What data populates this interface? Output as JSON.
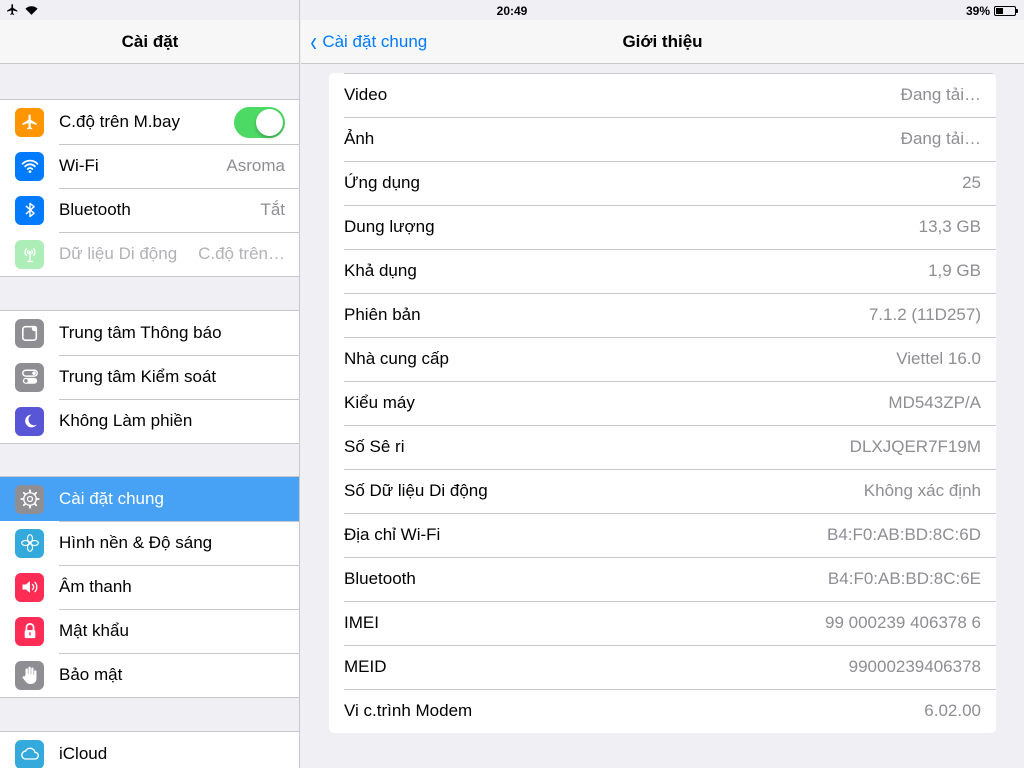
{
  "status_bar": {
    "time": "20:49",
    "battery_percent_text": "39%",
    "battery_level": 0.39
  },
  "sidebar": {
    "title": "Cài đặt",
    "groups": [
      [
        {
          "label": "C.độ trên M.bay",
          "icon": "airplane-icon",
          "icon_color": "#ff9500",
          "toggle_on": true
        },
        {
          "label": "Wi-Fi",
          "value": "Asroma",
          "icon": "wifi-icon",
          "icon_color": "#007aff"
        },
        {
          "label": "Bluetooth",
          "value": "Tắt",
          "icon": "bluetooth-icon",
          "icon_color": "#007aff"
        },
        {
          "label": "Dữ liệu Di động",
          "value": "C.độ trên…",
          "icon": "cellular-icon",
          "icon_color": "#4cd964",
          "disabled": true
        }
      ],
      [
        {
          "label": "Trung tâm Thông báo",
          "icon": "notification-center-icon",
          "icon_color": "#8e8e93"
        },
        {
          "label": "Trung tâm Kiểm soát",
          "icon": "control-center-icon",
          "icon_color": "#8e8e93"
        },
        {
          "label": "Không Làm phiền",
          "icon": "moon-icon",
          "icon_color": "#5856d6"
        }
      ],
      [
        {
          "label": "Cài đặt chung",
          "icon": "gear-icon",
          "icon_color": "#8e8e93",
          "selected": true
        },
        {
          "label": "Hình nền & Độ sáng",
          "icon": "wallpaper-flower-icon",
          "icon_color": "#34aadc"
        },
        {
          "label": "Âm thanh",
          "icon": "speaker-icon",
          "icon_color": "#ff2d55"
        },
        {
          "label": "Mật khẩu",
          "icon": "lock-icon",
          "icon_color": "#ff2d55"
        },
        {
          "label": "Bảo mật",
          "icon": "hand-icon",
          "icon_color": "#8e8e93"
        }
      ],
      [
        {
          "label": "iCloud",
          "icon": "cloud-icon",
          "icon_color": "#007aff"
        }
      ]
    ]
  },
  "detail": {
    "back_label": "Cài đặt chung",
    "title": "Giới thiệu",
    "rows": [
      {
        "label": "Video",
        "value": "Đang tải…"
      },
      {
        "label": "Ảnh",
        "value": "Đang tải…"
      },
      {
        "label": "Ứng dụng",
        "value": "25"
      },
      {
        "label": "Dung lượng",
        "value": "13,3 GB"
      },
      {
        "label": "Khả dụng",
        "value": "1,9 GB"
      },
      {
        "label": "Phiên bản",
        "value": "7.1.2 (11D257)"
      },
      {
        "label": "Nhà cung cấp",
        "value": "Viettel 16.0"
      },
      {
        "label": "Kiểu máy",
        "value": "MD543ZP/A"
      },
      {
        "label": "Số Sê ri",
        "value": "DLXJQER7F19M"
      },
      {
        "label": "Số Dữ liệu Di động",
        "value": "Không xác định"
      },
      {
        "label": "Địa chỉ Wi-Fi",
        "value": "B4:F0:AB:BD:8C:6D"
      },
      {
        "label": "Bluetooth",
        "value": "B4:F0:AB:BD:8C:6E"
      },
      {
        "label": "IMEI",
        "value": "99 000239 406378 6"
      },
      {
        "label": "MEID",
        "value": "99000239406378"
      },
      {
        "label": "Vi c.trình Modem",
        "value": "6.02.00"
      }
    ]
  }
}
